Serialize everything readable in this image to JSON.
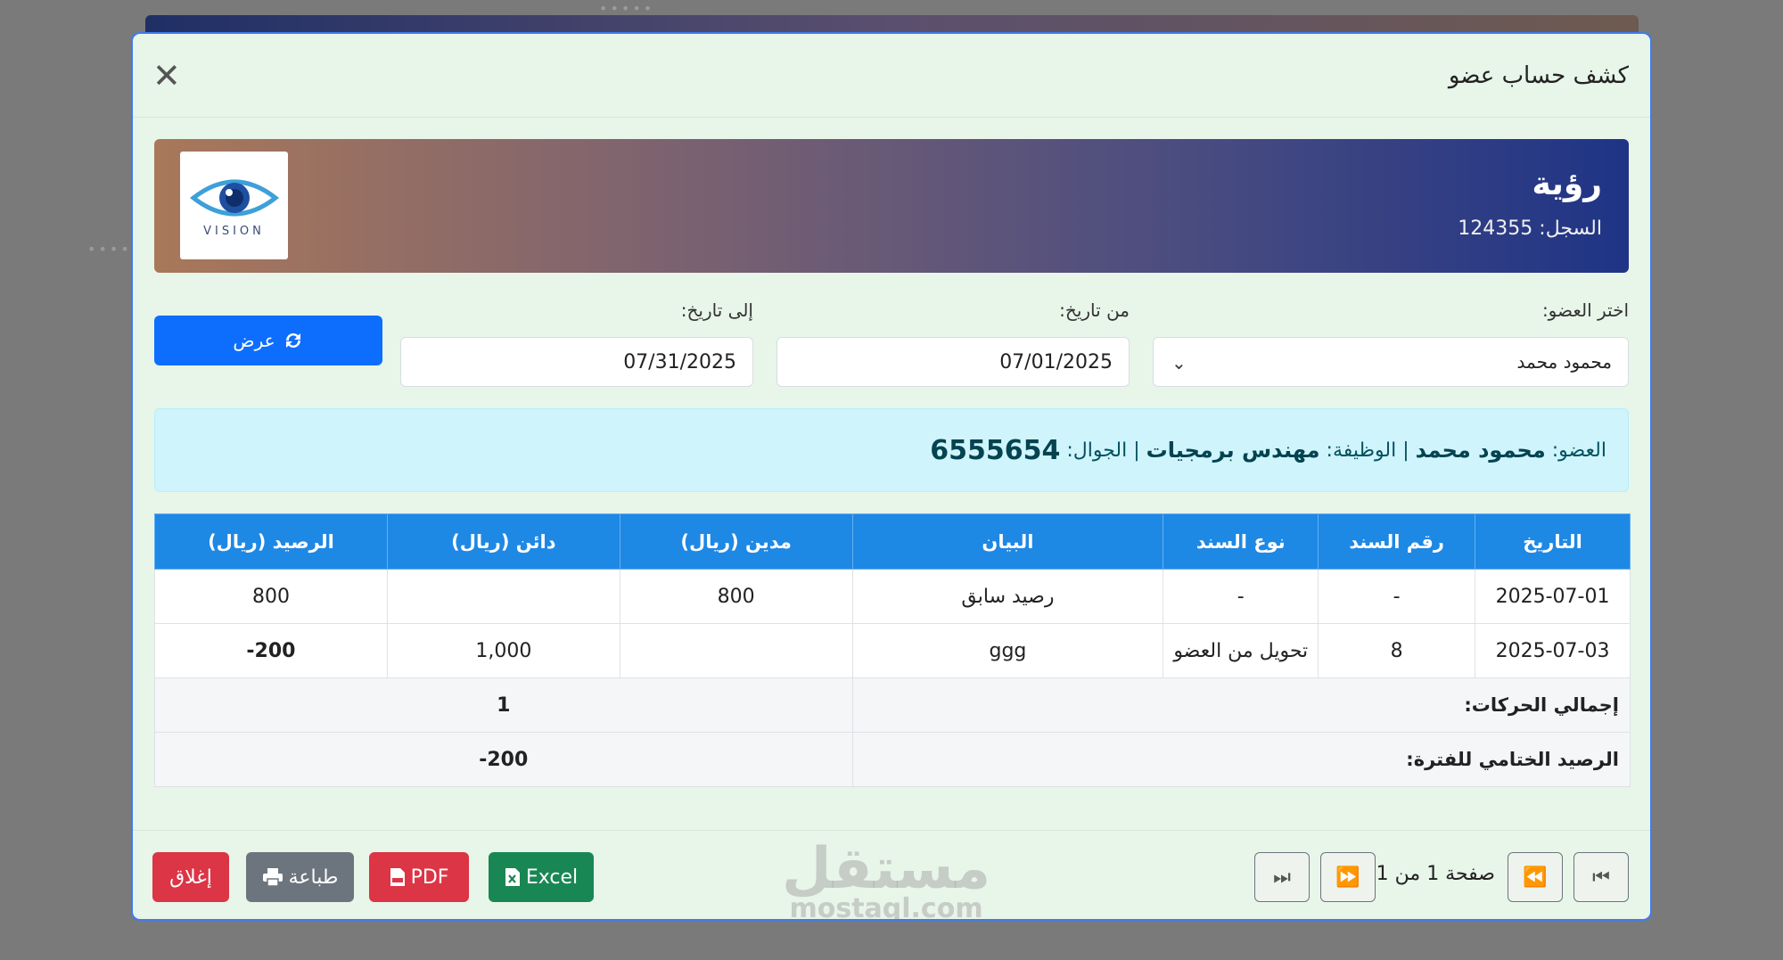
{
  "modal": {
    "title": "كشف حساب عضو",
    "close_icon": "close-icon"
  },
  "banner": {
    "org_name": "رؤية",
    "registry_label": "السجل:",
    "registry_value": "124355",
    "logo_text": "VISION"
  },
  "filters": {
    "member_label": "اختر العضو:",
    "member_value": "محمود محمد",
    "from_label": "من تاريخ:",
    "from_value": "07/01/2025",
    "to_label": "إلى تاريخ:",
    "to_value": "07/31/2025",
    "show_button": "عرض"
  },
  "member_info": {
    "member_label": "العضو:",
    "member_name": "محمود محمد",
    "job_label": "الوظيفة:",
    "job_value": "مهندس برمجيات",
    "phone_label": "الجوال:",
    "phone_value": "6555654",
    "separator": "|"
  },
  "table": {
    "headers": [
      "التاريخ",
      "رقم السند",
      "نوع السند",
      "البيان",
      "مدين (ريال)",
      "دائن (ريال)",
      "الرصيد (ريال)"
    ],
    "rows": [
      [
        "2025-07-01",
        "-",
        "-",
        "رصيد سابق",
        "800",
        "",
        "800"
      ],
      [
        "2025-07-03",
        "8",
        "تحويل من العضو",
        "ggg",
        "",
        "1,000",
        "200-"
      ]
    ],
    "total_label": "إجمالي الحركات:",
    "total_value": "1",
    "closing_label": "الرصيد الختامي للفترة:",
    "closing_value": "200-"
  },
  "footer": {
    "close_button": "إغلاق",
    "print_button": "طباعة",
    "pdf_button": "PDF",
    "excel_button": "Excel",
    "page_info": "صفحة 1 من 1",
    "watermark_ar": "مستقل",
    "watermark_en": "mostaql.com"
  },
  "colors": {
    "primary": "#0d6efd",
    "header_blue": "#1e88e5",
    "danger": "#dc3545",
    "secondary": "#6c757d",
    "success": "#198754",
    "negative_text": "#c62828"
  }
}
